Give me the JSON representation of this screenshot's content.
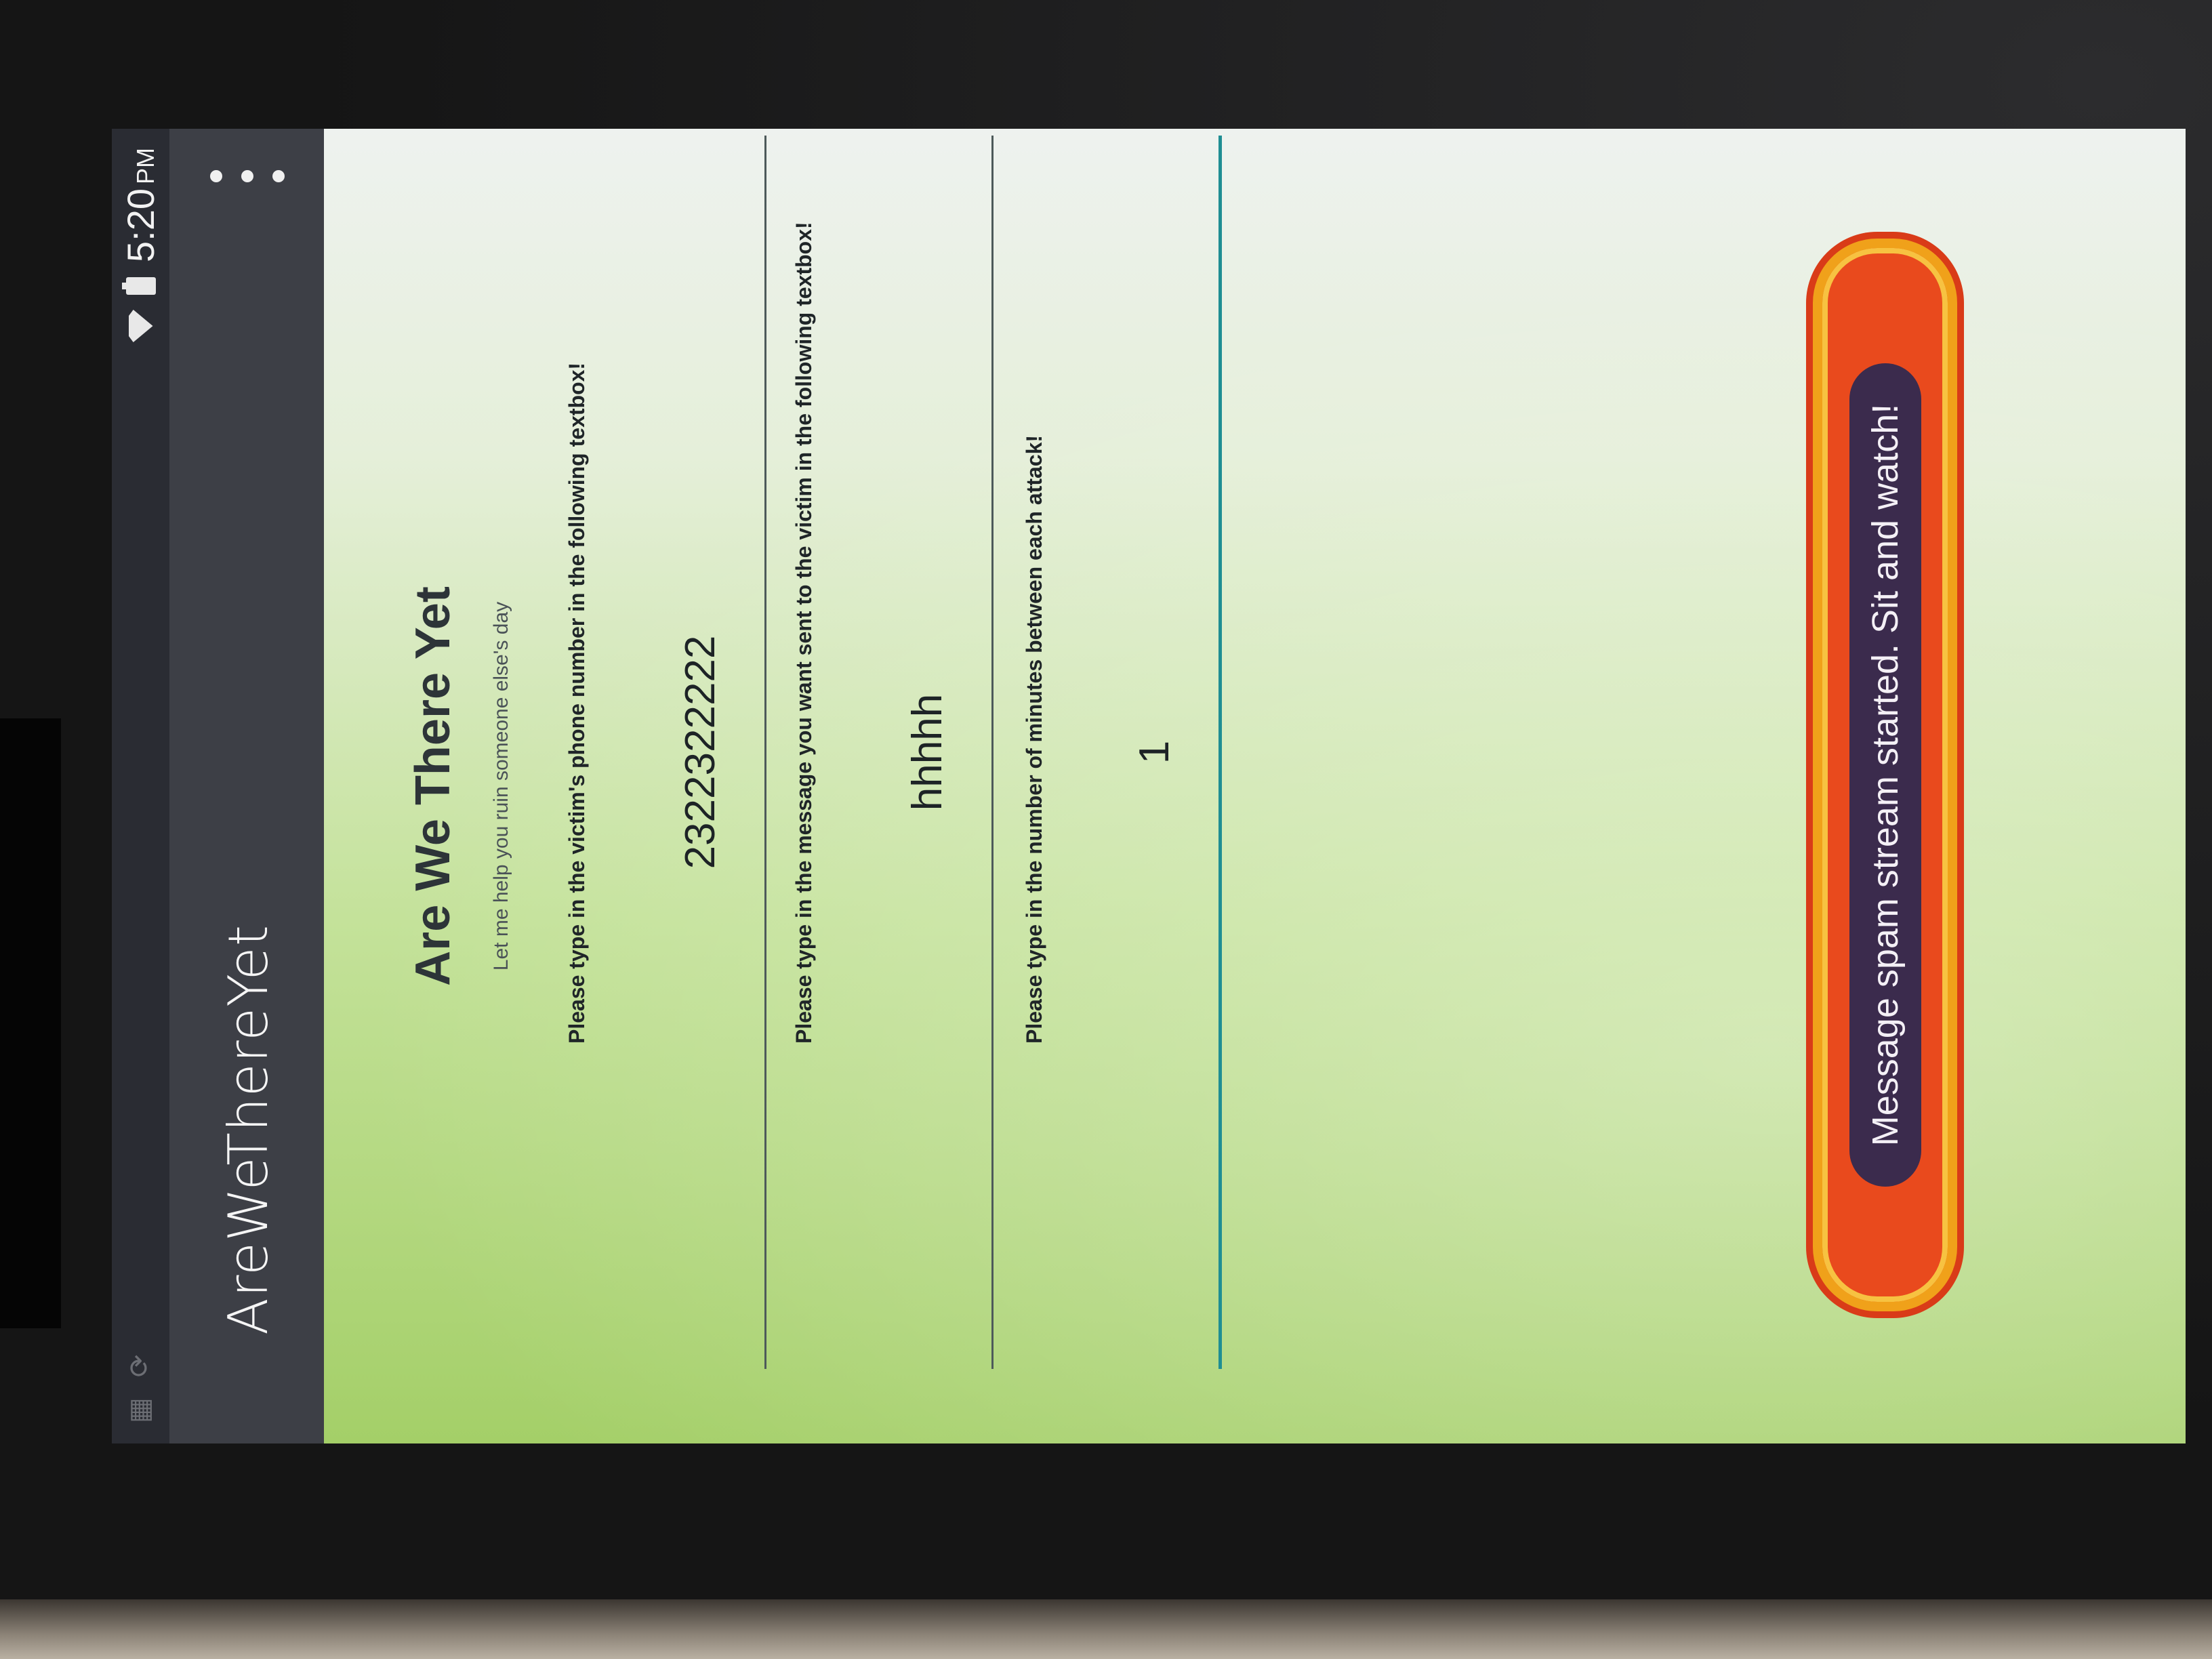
{
  "status_bar": {
    "time": "5:20",
    "ampm": "PM"
  },
  "action_bar": {
    "title": "AreWeThereYet"
  },
  "main": {
    "heading": "Are We There Yet",
    "subtitle": "Let me help you ruin someone else's day",
    "phone_prompt": "Please type in the victim's phone number in the following textbox!",
    "phone_value": "2322322222",
    "message_prompt": "Please type in the message you want sent to the victim in the following textbox!",
    "message_value": "hhhhh",
    "minutes_prompt": "Please type in the number of minutes between each attack!",
    "minutes_value": "1"
  },
  "toast": {
    "text": "Message spam stream started. Sit and watch!"
  },
  "colors": {
    "action_bar": "#3d3f46",
    "status_bar": "#2a2c33",
    "focus_underline": "#1f8e93",
    "toast_fill": "#e94a1d",
    "toast_inner": "#3b2b4d"
  }
}
